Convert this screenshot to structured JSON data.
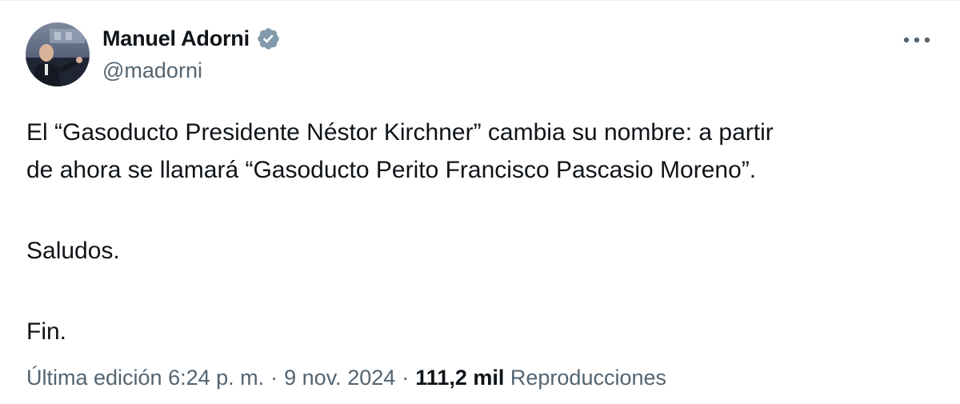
{
  "author": {
    "display_name": "Manuel Adorni",
    "handle": "@madorni",
    "verified": true,
    "avatar_icon": "profile-photo"
  },
  "tweet": {
    "text_lines": [
      "El “Gasoducto Presidente Néstor Kirchner” cambia su nombre: a partir",
      "de ahora se llamará “Gasoducto Perito Francisco Pascasio Moreno”."
    ],
    "greeting": "Saludos.",
    "closing": "Fin."
  },
  "meta": {
    "edited_time": "Última edición 6:24 p. m.",
    "separator": "·",
    "date": "9 nov. 2024",
    "views_count": "111,2 mil",
    "views_label": "Reproducciones"
  },
  "colors": {
    "text": "#0f1419",
    "secondary": "#536471",
    "verified_badge": "#829aab"
  },
  "icons": {
    "more": "more-horizontal-icon",
    "verified": "verified-badge-icon"
  }
}
